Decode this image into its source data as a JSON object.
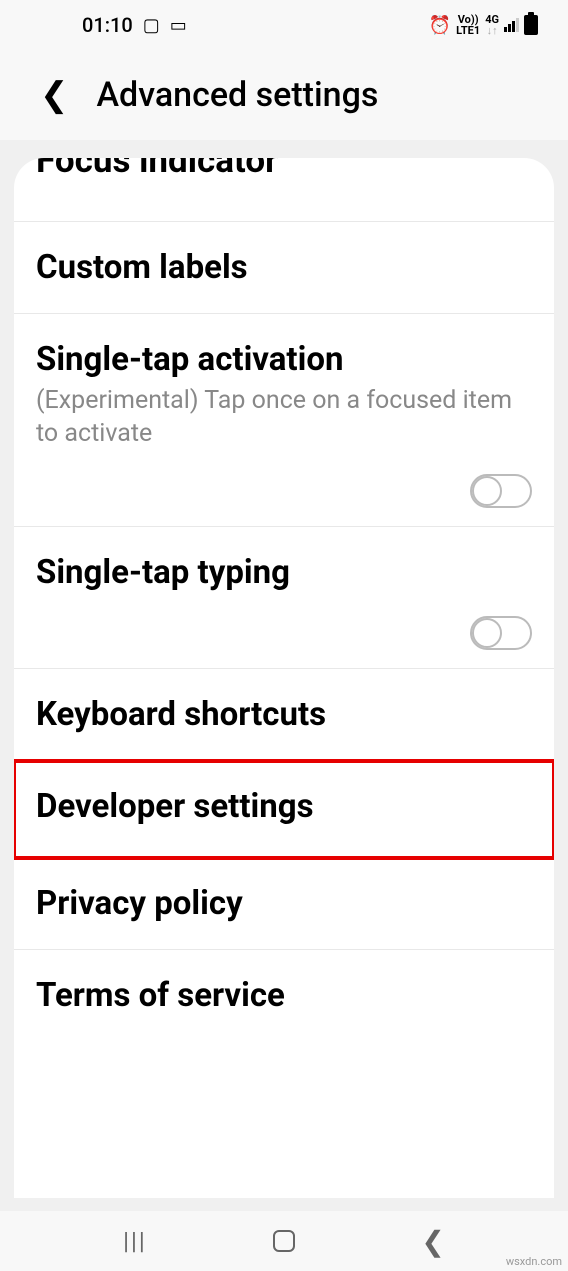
{
  "status": {
    "time": "01:10",
    "lte_label": "LTE1",
    "vo_label": "Vo))",
    "net_label": "4G"
  },
  "header": {
    "title": "Advanced settings"
  },
  "items": {
    "cutoff": "Focus indicator",
    "custom_labels": "Custom labels",
    "single_tap_activation": {
      "title": "Single-tap activation",
      "desc": "(Experimental) Tap once on a focused item to activate"
    },
    "single_tap_typing": "Single-tap typing",
    "keyboard_shortcuts": "Keyboard shortcuts",
    "developer_settings": "Developer settings",
    "privacy_policy": "Privacy policy",
    "terms_of_service": "Terms of service"
  },
  "watermark": "wsxdn.com"
}
